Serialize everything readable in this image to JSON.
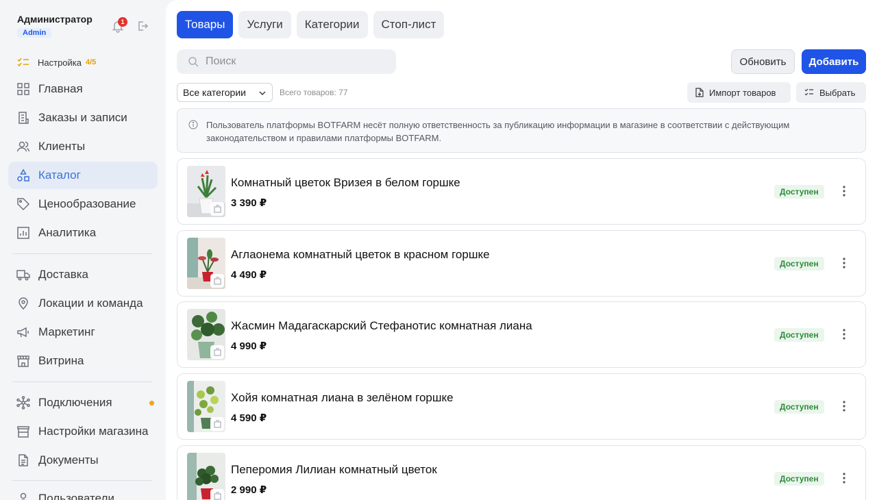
{
  "user": {
    "name": "Администратор",
    "role": "Admin",
    "notifications": "1"
  },
  "setup": {
    "label": "Настройка",
    "progress": "4/5"
  },
  "nav": {
    "home": "Главная",
    "orders": "Заказы и записи",
    "clients": "Клиенты",
    "catalog": "Каталог",
    "pricing": "Ценообразование",
    "analytics": "Аналитика",
    "delivery": "Доставка",
    "locations": "Локации и команда",
    "marketing": "Маркетинг",
    "showcase": "Витрина",
    "connections": "Подключения",
    "store_settings": "Настройки магазина",
    "documents": "Документы",
    "users": "Пользователи"
  },
  "tabs": [
    "Товары",
    "Услуги",
    "Категории",
    "Стоп-лист"
  ],
  "search": {
    "placeholder": "Поиск"
  },
  "toolbar": {
    "refresh": "Обновить",
    "add": "Добавить",
    "import": "Импорт товаров",
    "select": "Выбрать"
  },
  "filter": {
    "category_selected": "Все категории",
    "total": "Всего товаров: 77"
  },
  "notice": "Пользователь платформы BOTFARM несёт полную ответственность за публикацию информации в магазине в соответствии с действующим законодательством и правилами платформы BOTFARM.",
  "products": [
    {
      "name": "Комнатный цветок Вризея в белом горшке",
      "price": "3 390 ₽",
      "status": "Доступен"
    },
    {
      "name": "Аглаонема комнатный цветок в красном горшке",
      "price": "4 490 ₽",
      "status": "Доступен"
    },
    {
      "name": "Жасмин Мадагаскарский Стефанотис комнатная лиана",
      "price": "4 990 ₽",
      "status": "Доступен"
    },
    {
      "name": "Хойя комнатная лиана в зелёном горшке",
      "price": "4 590 ₽",
      "status": "Доступен"
    },
    {
      "name": "Пеперомия Лилиан комнатный цветок",
      "price": "2 990 ₽",
      "status": "Доступен"
    }
  ],
  "colors": {
    "accent": "#1f54e6",
    "available": "#2f8a3c",
    "badge": "#e5322d",
    "setup": "#e6a100",
    "dot": "#f2a317"
  }
}
